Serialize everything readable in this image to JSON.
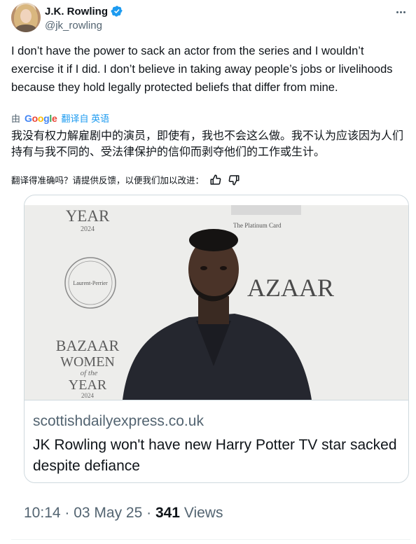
{
  "author": {
    "display_name": "J.K. Rowling",
    "handle": "@jk_rowling"
  },
  "tweet": {
    "text": "I don’t have the power to sack an actor from the series and I wouldn’t exercise it if I did. I don’t believe in taking away people’s jobs or livelihoods because they hold legally protected beliefs that differ from mine."
  },
  "translation": {
    "by_label": "由",
    "google_letters": [
      "G",
      "o",
      "o",
      "g",
      "l",
      "e"
    ],
    "translated_from": "翻译自 英语",
    "text": "我没有权力解雇剧中的演员，即使有，我也不会这么做。我不认为应该因为人们持有与我不同的、受法律保护的信仰而剥夺他们的工作或生计。",
    "feedback_prompt": "翻译得准确吗？请提供反馈，以便我们加以改进："
  },
  "card": {
    "image_texts": {
      "year_top": "YEAR",
      "year_top_num": "2024",
      "champagne_brand": "Laurent-Perrier",
      "platinum_card": "The Platinum Card",
      "bazaar_right": "AZAAR",
      "bazaar_left": "BAZAAR",
      "women": "WOMEN",
      "of_the": "of the",
      "year_bottom": "YEAR",
      "year_bottom_num": "2024"
    },
    "domain": "scottishdailyexpress.co.uk",
    "title": "JK Rowling won't have new Harry Potter TV star sacked despite defiance"
  },
  "meta": {
    "time": "10:14 · 03 May 25 · ",
    "views_count": "341",
    "views_label": " Views"
  },
  "colors": {
    "accent": "#1d9bf0",
    "secondary_text": "#536471",
    "border": "#cfd9de"
  }
}
